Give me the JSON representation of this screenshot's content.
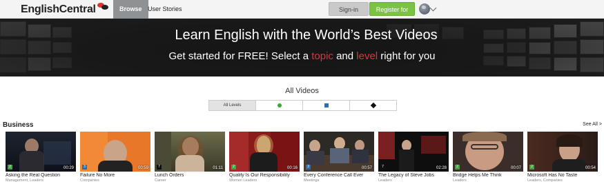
{
  "header": {
    "logo_text": "EnglishCentral",
    "tabs": [
      {
        "label": "Browse",
        "active": true
      },
      {
        "label": "User Stories",
        "active": false
      }
    ],
    "signin_label": "Sign-in",
    "register_label": "Register for Free",
    "language_icon": "globe-icon"
  },
  "hero": {
    "title": "Learn English with the World’s Best Videos",
    "subtitle_start": "Get started for FREE! Select a ",
    "subtitle_topic": "topic",
    "subtitle_mid": " and ",
    "subtitle_level": "level",
    "subtitle_end": " right for you",
    "highlight_color": "#d13b3b"
  },
  "videos": {
    "heading": "All Videos",
    "levels": [
      {
        "label": "All Levels",
        "icon": null,
        "selected": true
      },
      {
        "label": "",
        "icon": "green-circle-icon",
        "color": "#3fa53f"
      },
      {
        "label": "",
        "icon": "blue-square-icon",
        "color": "#2a6fb0"
      },
      {
        "label": "",
        "icon": "black-diamond-icon",
        "color": "#111111"
      }
    ]
  },
  "section": {
    "title": "Business",
    "see_all": "See All >",
    "items": [
      {
        "title": "Asking the Real Question",
        "tags": "Management, Leaders",
        "level": "2",
        "level_color": "#3fa53f",
        "duration": "00:29"
      },
      {
        "title": "Failure No More",
        "tags": "Companies",
        "level": "3",
        "level_color": "#2a6fb0",
        "duration": "00:59"
      },
      {
        "title": "Lunch Orders",
        "tags": "Career",
        "level": "7",
        "level_color": "#111111",
        "duration": "01:11"
      },
      {
        "title": "Quality Is Our Responsibility",
        "tags": "Women Leaders",
        "level": "2",
        "level_color": "#3fa53f",
        "duration": "00:16"
      },
      {
        "title": "Every Conference Call Ever",
        "tags": "Meetings",
        "level": "3",
        "level_color": "#2a6fb0",
        "duration": "00:57"
      },
      {
        "title": "The Legacy of Steve Jobs",
        "tags": "Leaders",
        "level": "7",
        "level_color": "#111111",
        "duration": "02:28"
      },
      {
        "title": "Bridge Helps Me Think",
        "tags": "Leaders",
        "level": "2",
        "level_color": "#3fa53f",
        "duration": "00:07"
      },
      {
        "title": "Microsoft Has No Taste",
        "tags": "Leaders, Companies",
        "level": "2",
        "level_color": "#3fa53f",
        "duration": "00:54"
      }
    ]
  }
}
